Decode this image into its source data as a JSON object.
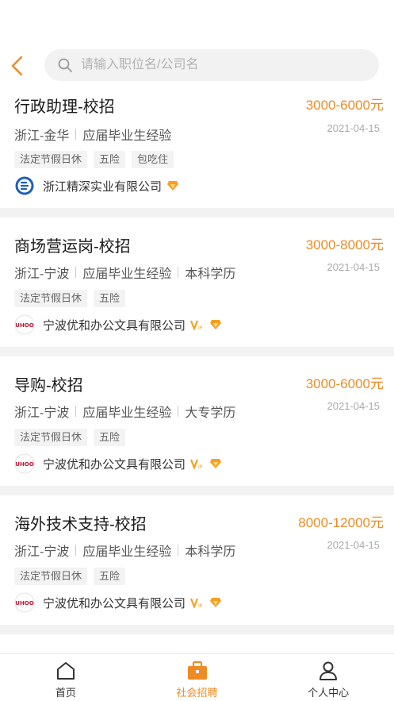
{
  "search": {
    "placeholder": "请输入职位名/公司名"
  },
  "jobs": [
    {
      "title": "行政助理-校招",
      "salary": "3000-6000元",
      "date": "2021-04-15",
      "location": "浙江-金华",
      "experience": "应届毕业生经验",
      "education": "",
      "tags": [
        "法定节假日休",
        "五险",
        "包吃住"
      ],
      "company": "浙江精深实业有限公司"
    },
    {
      "title": "商场营运岗-校招",
      "salary": "3000-8000元",
      "date": "2021-04-15",
      "location": "浙江-宁波",
      "experience": "应届毕业生经验",
      "education": "本科学历",
      "tags": [
        "法定节假日休",
        "五险"
      ],
      "company": "宁波优和办公文具有限公司"
    },
    {
      "title": "导购-校招",
      "salary": "3000-6000元",
      "date": "2021-04-15",
      "location": "浙江-宁波",
      "experience": "应届毕业生经验",
      "education": "大专学历",
      "tags": [
        "法定节假日休",
        "五险"
      ],
      "company": "宁波优和办公文具有限公司"
    },
    {
      "title": "海外技术支持-校招",
      "salary": "8000-12000元",
      "date": "2021-04-15",
      "location": "浙江-宁波",
      "experience": "应届毕业生经验",
      "education": "本科学历",
      "tags": [
        "法定节假日休",
        "五险"
      ],
      "company": "宁波优和办公文具有限公司"
    }
  ],
  "logo_text": "UHOO",
  "tabbar": {
    "items": [
      {
        "label": "首页",
        "icon": "home-icon"
      },
      {
        "label": "社会招聘",
        "icon": "briefcase-icon"
      },
      {
        "label": "个人中心",
        "icon": "user-icon"
      }
    ],
    "active": 1
  },
  "colors": {
    "accent": "#f08a24",
    "diamond": "#f5a020"
  }
}
